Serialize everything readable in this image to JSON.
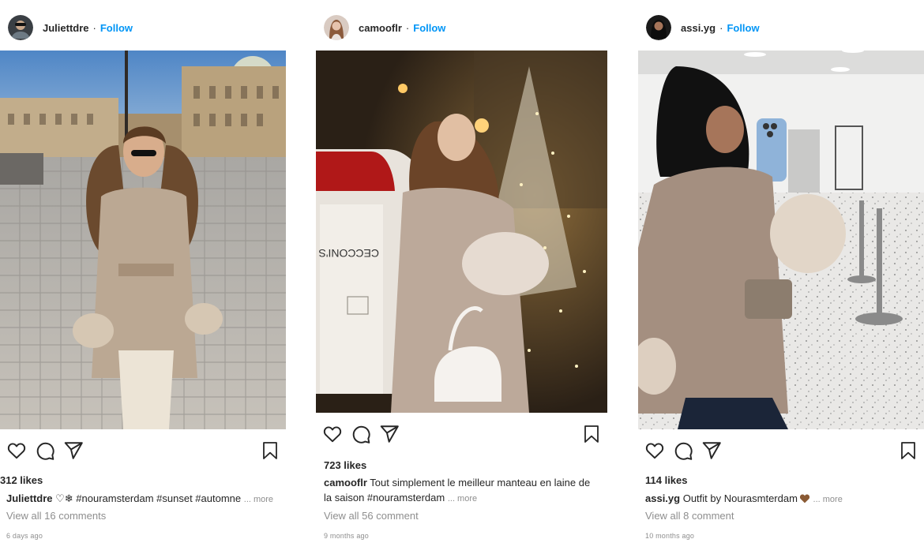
{
  "posts": [
    {
      "username": "Juliettdre",
      "separator": "·",
      "follow_label": "Follow",
      "likes": "312 likes",
      "caption_user": "Juliettdre",
      "caption_text": " ♡❄ #nouramsterdam #sunset #automne",
      "more_label": "... more",
      "comments": "View all 16 comments",
      "time": "6 days ago"
    },
    {
      "username": "camooflr",
      "separator": "·",
      "follow_label": "Follow",
      "likes": "723 likes",
      "caption_user": "camooflr",
      "caption_text": " Tout simplement le meilleur manteau en laine de la saison #nouramsterdam",
      "more_label": "... more",
      "comments": "View all 56 comment",
      "time": "9 months ago"
    },
    {
      "username": "assi.yg",
      "separator": "·",
      "follow_label": "Follow",
      "likes": "114 likes",
      "caption_user": "assi.yg",
      "caption_text": " Outfit by Nourasmterdam",
      "more_label": "... more",
      "comments": "View all 8 comment",
      "time": "10 months ago"
    }
  ],
  "icons": {
    "like": "heart-outline",
    "comment": "speech-bubble-outline",
    "share": "paper-plane-outline",
    "save": "bookmark-outline"
  },
  "colors": {
    "follow": "#0095f6",
    "text": "#262626",
    "muted": "#8e8e8e"
  }
}
